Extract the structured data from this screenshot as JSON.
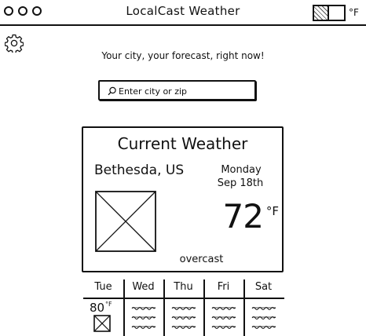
{
  "window": {
    "title": "LocalCast Weather",
    "unit_label": "°F"
  },
  "header": {
    "tagline": "Your city, your forecast, right now!"
  },
  "search": {
    "placeholder": "Enter city or zip",
    "value": ""
  },
  "current": {
    "title": "Current Weather",
    "location": "Bethesda, US",
    "day": "Monday",
    "date": "Sep 18th",
    "temperature": "72",
    "unit": "°F",
    "description": "overcast"
  },
  "forecast": {
    "days": [
      {
        "name": "Tue",
        "temperature": "80",
        "unit": "°F"
      },
      {
        "name": "Wed"
      },
      {
        "name": "Thu"
      },
      {
        "name": "Fri"
      },
      {
        "name": "Sat"
      }
    ]
  },
  "icons": {
    "window_controls": [
      "circle-icon",
      "circle-icon",
      "circle-icon"
    ],
    "settings": "gear-icon",
    "search": "search-icon",
    "weather": "image-placeholder-icon"
  }
}
